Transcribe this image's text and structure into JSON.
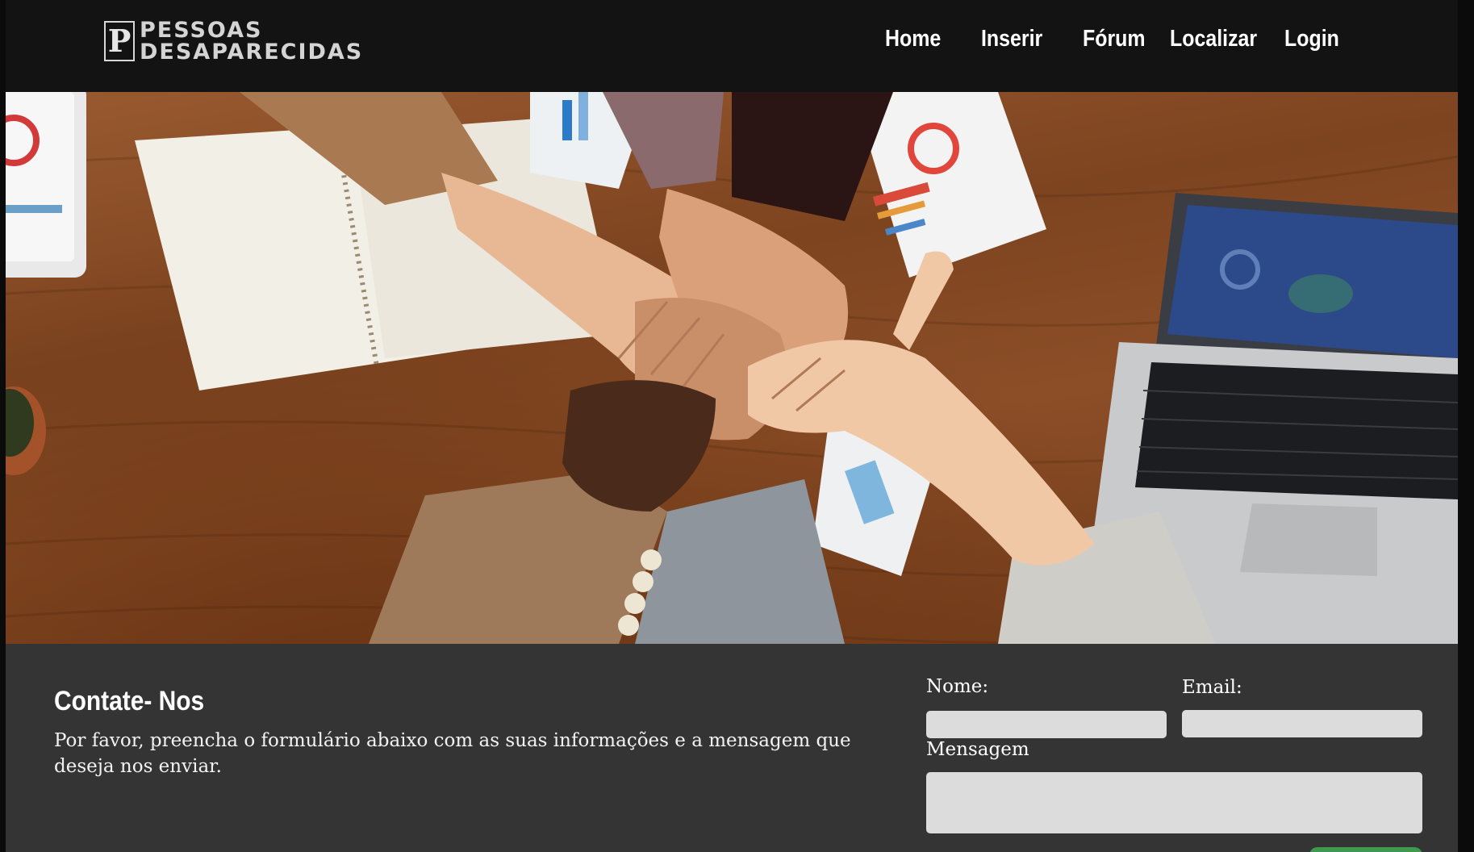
{
  "brand": {
    "mark": "P",
    "line1": "PESSOAS",
    "line2": "DESAPARECIDAS"
  },
  "nav": {
    "home": "Home",
    "inserir": "Inserir",
    "forum": "Fórum",
    "localizar": "Localizar",
    "login": "Login"
  },
  "hero": {
    "icon": "teamwork-hands-photo"
  },
  "contact": {
    "title": "Contate- Nos",
    "description": "Por favor, preencha o formulário abaixo com as suas informações e a mensagem que deseja nos enviar.",
    "name_label": "Nome:",
    "email_label": "Email:",
    "message_label": "Mensagem",
    "name_value": "",
    "email_value": "",
    "message_value": "",
    "send_label": ""
  },
  "colors": {
    "header_bg": "#131313",
    "section_bg": "#343434",
    "button_green": "#3f9a4f"
  }
}
